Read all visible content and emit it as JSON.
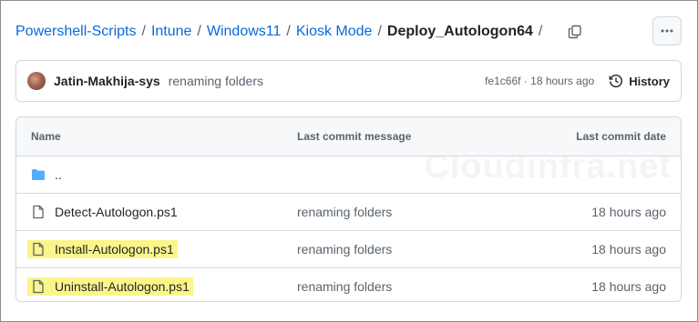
{
  "breadcrumb": {
    "items": [
      "Powershell-Scripts",
      "Intune",
      "Windows11",
      "Kiosk Mode"
    ],
    "separator": "/",
    "current": "Deploy_Autologon64"
  },
  "commit": {
    "author": "Jatin-Makhija-sys",
    "message": "renaming folders",
    "sha": "fe1c66f",
    "meta_sep": " · ",
    "time": "18 hours ago",
    "history_label": "History"
  },
  "table": {
    "headers": {
      "name": "Name",
      "message": "Last commit message",
      "date": "Last commit date"
    },
    "parent": "..",
    "rows": [
      {
        "name": "Detect-Autologon.ps1",
        "message": "renaming folders",
        "date": "18 hours ago",
        "highlighted": false
      },
      {
        "name": "Install-Autologon.ps1",
        "message": "renaming folders",
        "date": "18 hours ago",
        "highlighted": true
      },
      {
        "name": "Uninstall-Autologon.ps1",
        "message": "renaming folders",
        "date": "18 hours ago",
        "highlighted": true
      }
    ]
  },
  "watermark": "Cloudinfra.net",
  "icons": {
    "copy": "copy-icon",
    "more": "kebab-horizontal-icon",
    "history": "history-clock-icon",
    "folder": "folder-icon",
    "file": "file-icon"
  },
  "colors": {
    "link": "#0969da",
    "muted": "#59636e",
    "border": "#d1d9e0",
    "folder": "#54aeff",
    "highlight": "#fbf58a"
  }
}
